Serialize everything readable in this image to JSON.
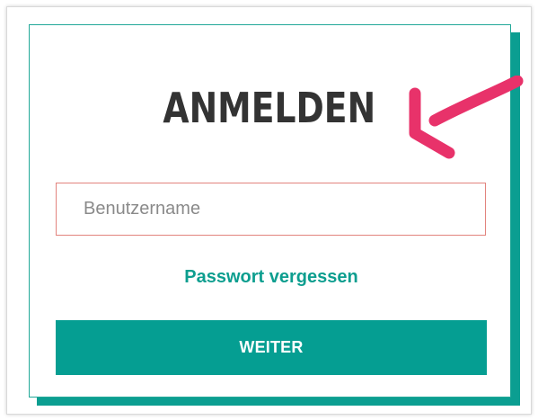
{
  "login": {
    "title": "ANMELDEN",
    "username_placeholder": "Benutzername",
    "username_value": "",
    "forgot_password_label": "Passwort vergessen",
    "continue_label": "WEITER"
  },
  "annotation": {
    "icon": "arrow-icon",
    "color": "#e8326a"
  },
  "colors": {
    "accent": "#059e92",
    "input_border": "#e2837d",
    "title": "#333333"
  }
}
